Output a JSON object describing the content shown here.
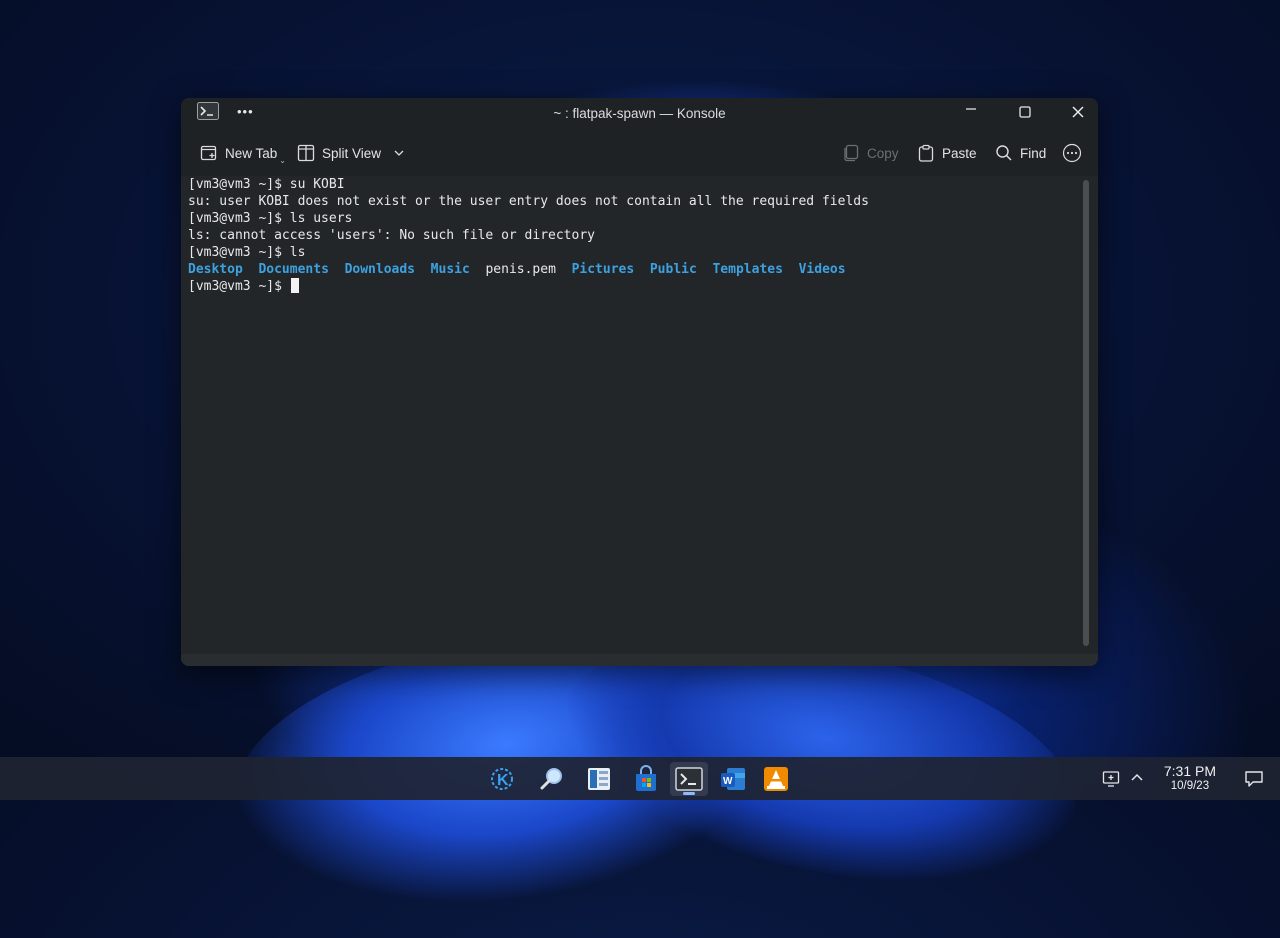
{
  "window": {
    "title": "~ : flatpak-spawn — Konsole",
    "more_label": "•••"
  },
  "toolbar": {
    "new_tab": "New Tab",
    "split_view": "Split View",
    "copy": "Copy",
    "paste": "Paste",
    "find": "Find"
  },
  "terminal": {
    "lines": [
      "[vm3@vm3 ~]$ su KOBI",
      "su: user KOBI does not exist or the user entry does not contain all the required fields",
      "[vm3@vm3 ~]$ ls users",
      "ls: cannot access 'users': No such file or directory",
      "[vm3@vm3 ~]$ ls"
    ],
    "listing": [
      "Desktop",
      "Documents",
      "Downloads",
      "Music",
      "penis.pem",
      "Pictures",
      "Public",
      "Templates",
      "Videos"
    ],
    "prompt": "[vm3@vm3 ~]$ "
  },
  "taskbar": {
    "apps": [
      "kde-launcher-icon",
      "search-icon",
      "file-manager-icon",
      "store-icon",
      "terminal-icon",
      "word-icon",
      "vlc-icon"
    ],
    "time": "7:31 PM",
    "date": "10/9/23"
  },
  "colors": {
    "accent_dir": "#3da1e0",
    "terminal_bg": "#232629"
  }
}
